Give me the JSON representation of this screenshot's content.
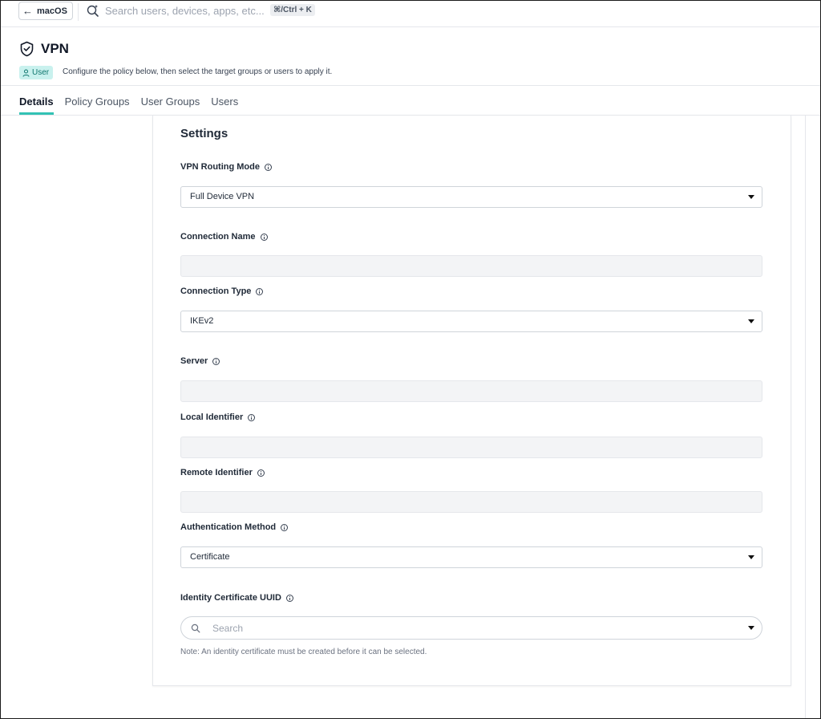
{
  "topbar": {
    "back_label": "macOS",
    "search_placeholder": "Search users, devices, apps, etc...",
    "shortcut": "⌘/Ctrl + K"
  },
  "header": {
    "title": "VPN",
    "badge": "User",
    "description": "Configure the policy below, then select the target groups or users to apply it."
  },
  "tabs": [
    "Details",
    "Policy Groups",
    "User Groups",
    "Users"
  ],
  "settings": {
    "title": "Settings",
    "fields": {
      "routing_mode": {
        "label": "VPN Routing Mode",
        "value": "Full Device VPN"
      },
      "connection_name": {
        "label": "Connection Name",
        "value": ""
      },
      "connection_type": {
        "label": "Connection Type",
        "value": "IKEv2"
      },
      "server": {
        "label": "Server",
        "value": ""
      },
      "local_identifier": {
        "label": "Local Identifier",
        "value": ""
      },
      "remote_identifier": {
        "label": "Remote Identifier",
        "value": ""
      },
      "auth_method": {
        "label": "Authentication Method",
        "value": "Certificate"
      },
      "identity_cert": {
        "label": "Identity Certificate UUID",
        "placeholder": "Search"
      }
    },
    "note": "Note: An identity certificate must be created before it can be selected."
  },
  "colors": {
    "accent": "#33c2b4",
    "badge_bg": "#c9f1ee"
  }
}
